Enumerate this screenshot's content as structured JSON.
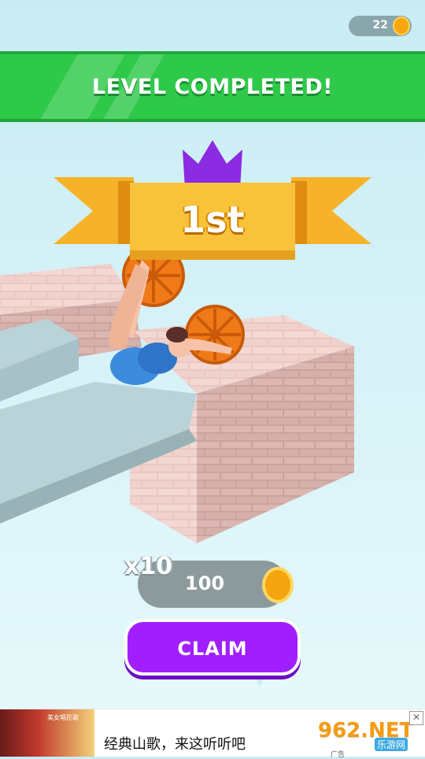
{
  "hud": {
    "coins": "22"
  },
  "banner": {
    "title": "LEVEL COMPLETED!"
  },
  "result": {
    "rank": "1st"
  },
  "reward": {
    "multiplier": "x10",
    "amount": "100"
  },
  "claim": {
    "label": "CLAIM"
  },
  "ad": {
    "text": "经典山歌，来这听听吧",
    "thumb_caption": "美女唱民歌",
    "logo_main": "962.NET",
    "logo_sub": "乐游网",
    "tag": "广告",
    "close": "✕"
  },
  "colors": {
    "banner_green": "#2fc94a",
    "ribbon_gold": "#f6b32a",
    "crown_purple": "#8b2be2",
    "claim_purple": "#a11fff",
    "coin_orange": "#f4a50f"
  }
}
